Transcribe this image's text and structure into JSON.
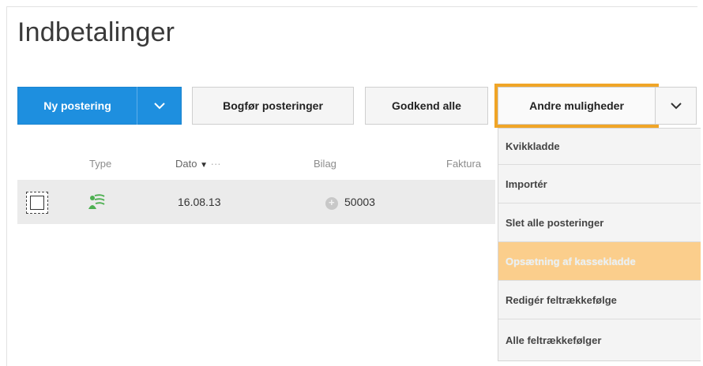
{
  "page": {
    "title": "Indbetalinger"
  },
  "toolbar": {
    "new_posting": "Ny postering",
    "post_entries": "Bogfør posteringer",
    "approve_all": "Godkend alle",
    "more_options": "Andre muligheder"
  },
  "table": {
    "columns": {
      "type": "Type",
      "date": "Dato",
      "date_more": "···",
      "voucher": "Bilag",
      "invoice": "Faktura"
    },
    "rows": [
      {
        "date": "16.08.13",
        "voucher": "50003",
        "type_icon": "journal-icon"
      }
    ]
  },
  "menu": {
    "items": [
      "Kvikkladde",
      "Importér",
      "Slet alle posteringer",
      "Opsætning af kassekladde",
      "Redigér feltrækkefølge",
      "Alle feltrækkefølger"
    ],
    "highlighted_index": 3
  },
  "colors": {
    "primary": "#1e8fdf",
    "highlight_border": "#f0a527",
    "menu_highlight": "#fbce8c",
    "icon_green": "#4caf50"
  }
}
